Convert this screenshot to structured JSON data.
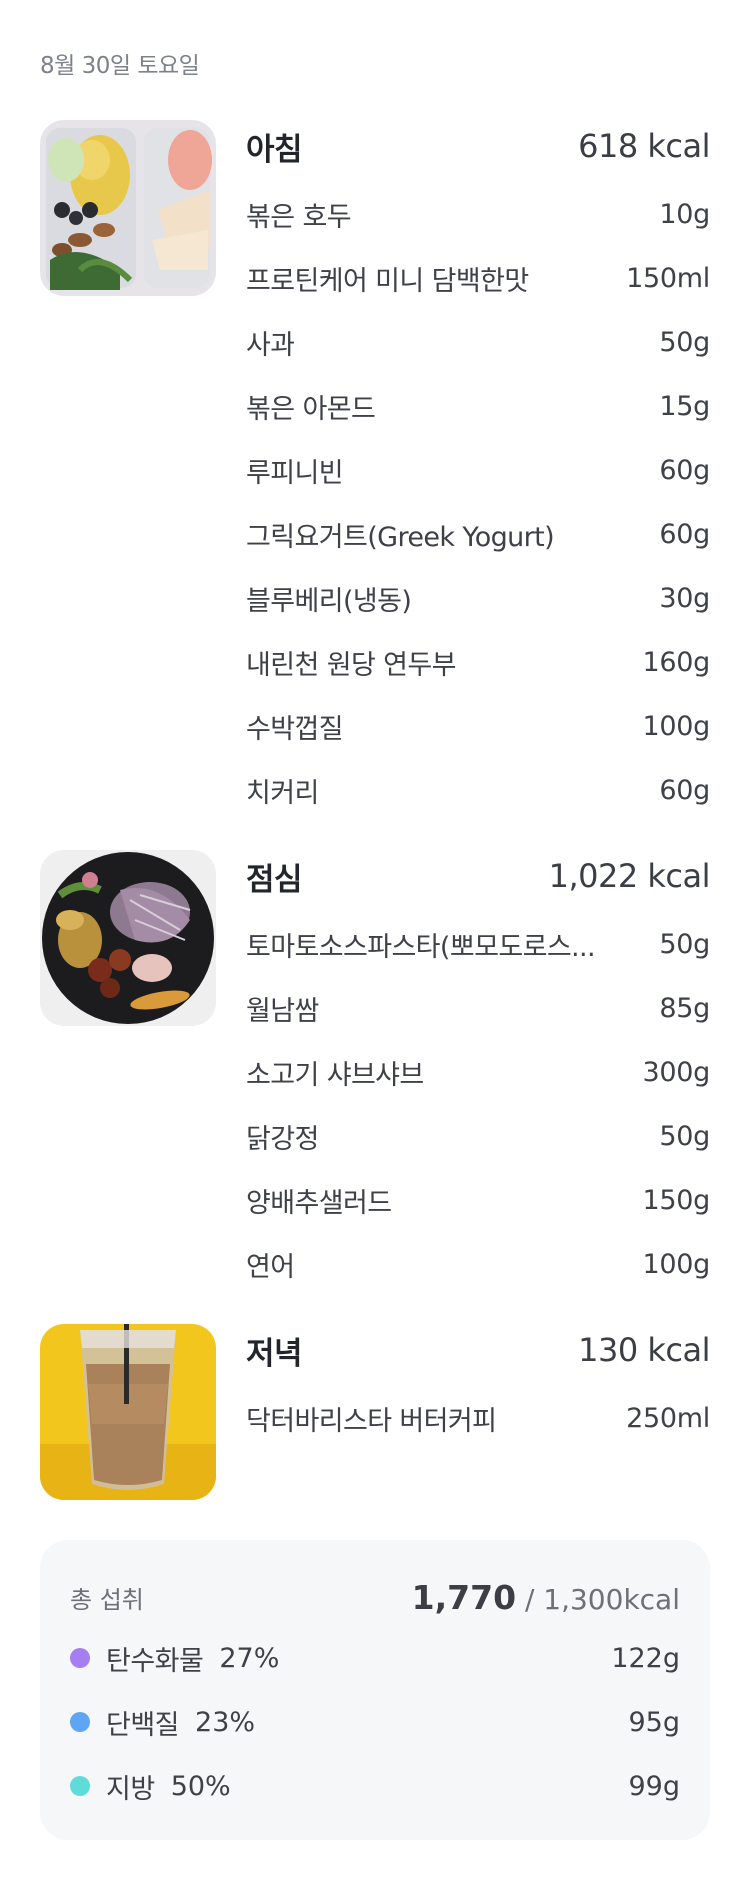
{
  "date": "8월 30일 토요일",
  "meals": [
    {
      "name": "아침",
      "kcal": "618 kcal",
      "photo": "breakfast-photo",
      "items": [
        {
          "name": "볶은 호두",
          "amount": "10g"
        },
        {
          "name": "프로틴케어 미니 담백한맛",
          "amount": "150ml"
        },
        {
          "name": "사과",
          "amount": "50g"
        },
        {
          "name": "볶은 아몬드",
          "amount": "15g"
        },
        {
          "name": "루피니빈",
          "amount": "60g"
        },
        {
          "name": "그릭요거트(Greek Yogurt)",
          "amount": "60g"
        },
        {
          "name": "블루베리(냉동)",
          "amount": "30g"
        },
        {
          "name": "내린천 원당 연두부",
          "amount": "160g"
        },
        {
          "name": "수박껍질",
          "amount": "100g"
        },
        {
          "name": "치커리",
          "amount": "60g"
        }
      ]
    },
    {
      "name": "점심",
      "kcal": "1,022 kcal",
      "photo": "lunch-photo",
      "items": [
        {
          "name": "토마토소스파스타(뽀모도로스...",
          "amount": "50g"
        },
        {
          "name": "월남쌈",
          "amount": "85g"
        },
        {
          "name": "소고기 샤브샤브",
          "amount": "300g"
        },
        {
          "name": "닭강정",
          "amount": "50g"
        },
        {
          "name": "양배추샐러드",
          "amount": "150g"
        },
        {
          "name": "연어",
          "amount": "100g"
        }
      ]
    },
    {
      "name": "저녁",
      "kcal": "130 kcal",
      "photo": "dinner-photo",
      "items": [
        {
          "name": "닥터바리스타 버터커피",
          "amount": "250ml"
        }
      ]
    }
  ],
  "summary": {
    "label": "총 섭취",
    "total": "1,770",
    "goal": " / 1,300kcal",
    "macros": [
      {
        "name": "탄수화물",
        "percent": "27%",
        "amount": "122g",
        "color": "#a57ef2"
      },
      {
        "name": "단백질",
        "percent": "23%",
        "amount": "95g",
        "color": "#5ea6f5"
      },
      {
        "name": "지방",
        "percent": "50%",
        "amount": "99g",
        "color": "#5fdcd8"
      }
    ]
  }
}
